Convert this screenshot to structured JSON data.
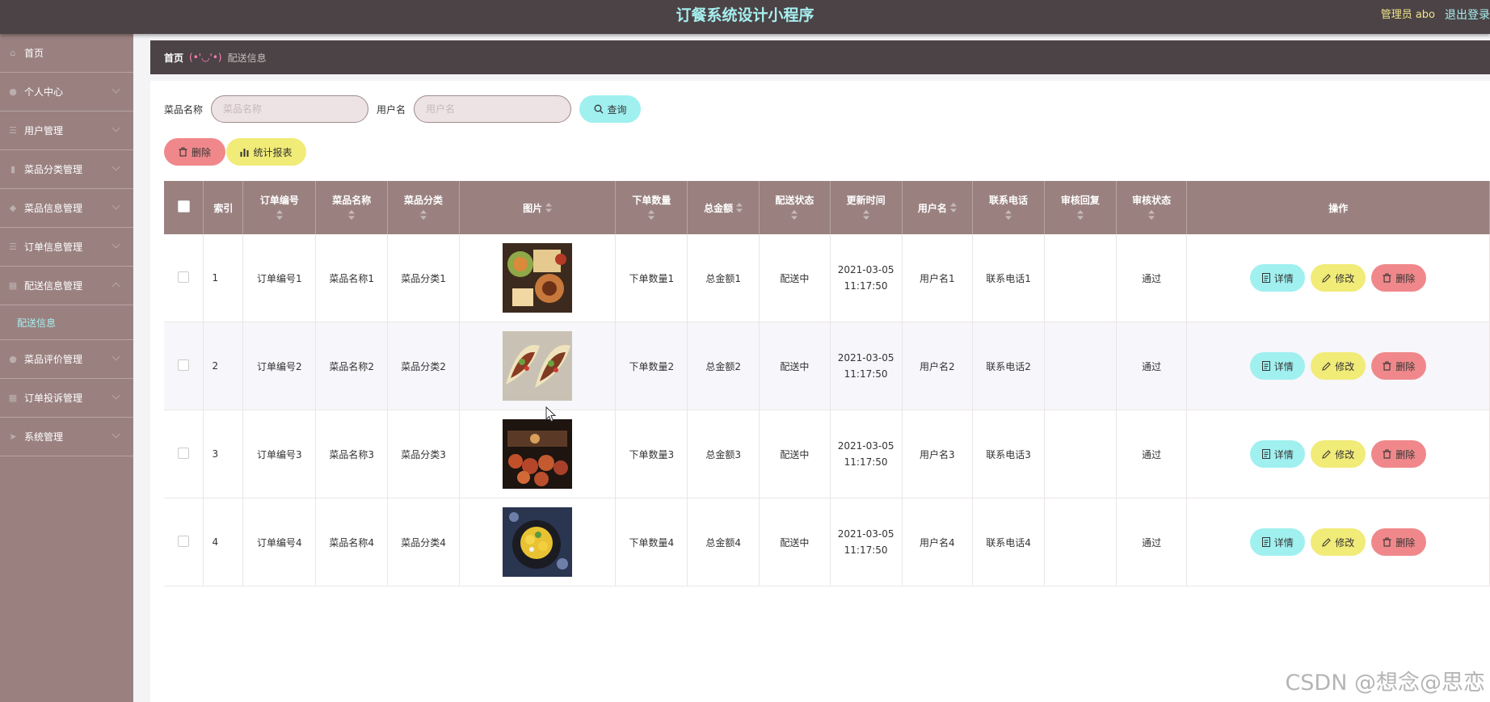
{
  "header": {
    "title": "订餐系统设计小程序",
    "admin": "管理员 abo",
    "logout": "退出登录"
  },
  "sidebar": {
    "items": [
      {
        "label": "首页",
        "icon": "home-icon",
        "has_children": false
      },
      {
        "label": "个人中心",
        "icon": "user-icon",
        "has_children": true
      },
      {
        "label": "用户管理",
        "icon": "list-icon",
        "has_children": true
      },
      {
        "label": "菜品分类管理",
        "icon": "chart-icon",
        "has_children": true
      },
      {
        "label": "菜品信息管理",
        "icon": "shield-icon",
        "has_children": true
      },
      {
        "label": "订单信息管理",
        "icon": "list-icon",
        "has_children": true
      },
      {
        "label": "配送信息管理",
        "icon": "grid-icon",
        "has_children": true,
        "expanded": true,
        "sub": [
          "配送信息"
        ]
      },
      {
        "label": "菜品评价管理",
        "icon": "user-icon",
        "has_children": true
      },
      {
        "label": "订单投诉管理",
        "icon": "grid-icon",
        "has_children": true
      },
      {
        "label": "系统管理",
        "icon": "send-icon",
        "has_children": true
      }
    ]
  },
  "breadcrumb": {
    "home": "首页",
    "sep": "(•'◡'•)",
    "current": "配送信息"
  },
  "search": {
    "dish_label": "菜品名称",
    "dish_placeholder": "菜品名称",
    "user_label": "用户名",
    "user_placeholder": "用户名",
    "query": "查询"
  },
  "actions": {
    "delete": "删除",
    "report": "统计报表"
  },
  "table": {
    "headers": [
      "索引",
      "订单编号",
      "菜品名称",
      "菜品分类",
      "图片",
      "下单数量",
      "总金额",
      "配送状态",
      "更新时间",
      "用户名",
      "联系电话",
      "审核回复",
      "审核状态",
      "操作"
    ],
    "rows": [
      {
        "index": "1",
        "order_no": "订单编号1",
        "dish": "菜品名称1",
        "category": "菜品分类1",
        "qty": "下单数量1",
        "total": "总金额1",
        "status": "配送中",
        "date": "2021-03-05",
        "time": "11:17:50",
        "user": "用户名1",
        "phone": "联系电话1",
        "reply": "",
        "audit": "通过"
      },
      {
        "index": "2",
        "order_no": "订单编号2",
        "dish": "菜品名称2",
        "category": "菜品分类2",
        "qty": "下单数量2",
        "total": "总金额2",
        "status": "配送中",
        "date": "2021-03-05",
        "time": "11:17:50",
        "user": "用户名2",
        "phone": "联系电话2",
        "reply": "",
        "audit": "通过"
      },
      {
        "index": "3",
        "order_no": "订单编号3",
        "dish": "菜品名称3",
        "category": "菜品分类3",
        "qty": "下单数量3",
        "total": "总金额3",
        "status": "配送中",
        "date": "2021-03-05",
        "time": "11:17:50",
        "user": "用户名3",
        "phone": "联系电话3",
        "reply": "",
        "audit": "通过"
      },
      {
        "index": "4",
        "order_no": "订单编号4",
        "dish": "菜品名称4",
        "category": "菜品分类4",
        "qty": "下单数量4",
        "total": "总金额4",
        "status": "配送中",
        "date": "2021-03-05",
        "time": "11:17:50",
        "user": "用户名4",
        "phone": "联系电话4",
        "reply": "",
        "audit": "通过"
      }
    ],
    "ops": {
      "detail": "详情",
      "edit": "修改",
      "delete": "删除"
    }
  },
  "watermark": "CSDN @想念@思恋",
  "colors": {
    "header_bg": "#4c4346",
    "sidebar_bg": "#9a8180",
    "accent_cyan": "#a0f0f0",
    "accent_yellow": "#f1eb77",
    "accent_red": "#f0888b",
    "title": "#a6efef",
    "admin": "#f0e58c"
  }
}
